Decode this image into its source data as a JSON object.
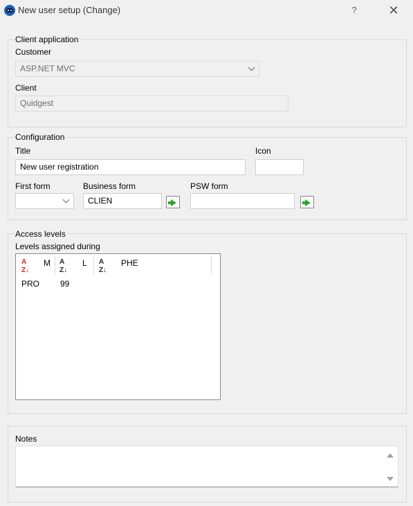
{
  "window": {
    "title": "New user setup (Change)",
    "help_label": "?",
    "close_label": "✕"
  },
  "client_application": {
    "legend": "Client application",
    "customer_label": "Customer",
    "customer_value": "ASP.NET MVC",
    "client_label": "Client",
    "client_value": "Quidgest"
  },
  "configuration": {
    "legend": "Configuration",
    "title_label": "Title",
    "title_value": "New user registration",
    "icon_label": "Icon",
    "icon_value": "",
    "first_form_label": "First form",
    "first_form_value": "",
    "business_form_label": "Business form",
    "business_form_value": "CLIEN",
    "psw_form_label": "PSW form",
    "psw_form_value": ""
  },
  "access_levels": {
    "legend": "Access levels",
    "list_label": "Levels assigned during",
    "columns": [
      "M",
      "L",
      "PHE"
    ],
    "sort_glyph": "A↓Z",
    "rows": [
      [
        "PRO",
        "99",
        ""
      ]
    ]
  },
  "notes": {
    "legend": "Notes",
    "value": ""
  },
  "colors": {
    "background": "#f0f0f0",
    "accent": "#1e5fb0",
    "go_arrow": "#2da52d",
    "sort_active": "#dd2222"
  }
}
